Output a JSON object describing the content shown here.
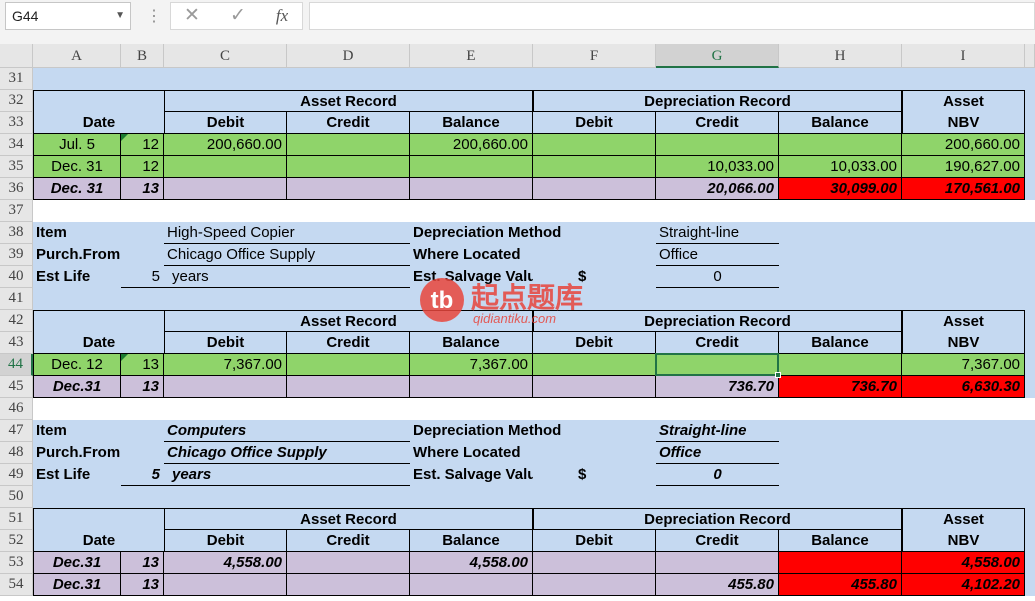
{
  "namebox": "G44",
  "icons": {
    "cancel": "close-icon",
    "confirm": "check-icon",
    "fx": "fx-icon"
  },
  "fx_label": "fx",
  "columns": [
    "A",
    "B",
    "C",
    "D",
    "E",
    "F",
    "G",
    "H",
    "I"
  ],
  "rows": [
    "31",
    "32",
    "33",
    "34",
    "35",
    "36",
    "37",
    "38",
    "39",
    "40",
    "41",
    "42",
    "43",
    "44",
    "45",
    "46",
    "47",
    "48",
    "49",
    "50",
    "51",
    "52",
    "53",
    "54"
  ],
  "section1": {
    "asset_record": "Asset Record",
    "depreciation_record": "Depreciation Record",
    "asset": "Asset",
    "date": "Date",
    "debit": "Debit",
    "credit": "Credit",
    "balance": "Balance",
    "nbv": "NBV",
    "r34": {
      "date": "Jul.  5",
      "yr": "12",
      "debit": "200,660.00",
      "balance": "200,660.00",
      "nbv": "200,660.00"
    },
    "r35": {
      "date": "Dec. 31",
      "yr": "12",
      "dcredit": "10,033.00",
      "dbalance": "10,033.00",
      "nbv": "190,627.00"
    },
    "r36": {
      "date": "Dec. 31",
      "yr": "13",
      "dcredit": "20,066.00",
      "dbalance": "30,099.00",
      "nbv": "170,561.00"
    }
  },
  "info1": {
    "item_label": "Item",
    "item": "High-Speed Copier",
    "purch_label": "Purch.From",
    "purch": "Chicago Office Supply",
    "life_label": "Est Life",
    "life": "5",
    "years": "years",
    "method_label": "Depreciation Method",
    "method": "Straight-line",
    "where_label": "Where Located",
    "where": "Office",
    "salvage_label": "Est. Salvage Value",
    "dollar": "$",
    "salvage": "0"
  },
  "section2": {
    "asset_record": "Asset Record",
    "depreciation_record": "Depreciation Record",
    "asset": "Asset",
    "date": "Date",
    "debit": "Debit",
    "credit": "Credit",
    "balance": "Balance",
    "nbv": "NBV",
    "r44": {
      "date": "Dec. 12",
      "yr": "13",
      "debit": "7,367.00",
      "balance": "7,367.00",
      "nbv": "7,367.00"
    },
    "r45": {
      "date": "Dec.31",
      "yr": "13",
      "dcredit": "736.70",
      "dbalance": "736.70",
      "nbv": "6,630.30"
    }
  },
  "info2": {
    "item_label": "Item",
    "item": "Computers",
    "purch_label": "Purch.From",
    "purch": "Chicago Office Supply",
    "life_label": "Est Life",
    "life": "5",
    "years": "years",
    "method_label": "Depreciation Method",
    "method": "Straight-line",
    "where_label": "Where Located",
    "where": "Office",
    "salvage_label": "Est. Salvage Value",
    "dollar": "$",
    "salvage": "0"
  },
  "section3": {
    "asset_record": "Asset Record",
    "depreciation_record": "Depreciation Record",
    "asset": "Asset",
    "date": "Date",
    "debit": "Debit",
    "credit": "Credit",
    "balance": "Balance",
    "nbv": "NBV",
    "r53": {
      "date": "Dec.31",
      "yr": "13",
      "debit": "4,558.00",
      "balance": "4,558.00",
      "nbv": "4,558.00"
    },
    "r54": {
      "date": "Dec.31",
      "yr": "13",
      "dcredit": "455.80",
      "dbalance": "455.80",
      "nbv": "4,102.20"
    }
  },
  "watermark": {
    "logo": "tb",
    "text": "起点题库",
    "url": "qidiantiku.com"
  },
  "colors": {
    "blue": "#c5d9f1",
    "green": "#8fd46a",
    "purple": "#ccc0da",
    "red": "#ff0000"
  }
}
